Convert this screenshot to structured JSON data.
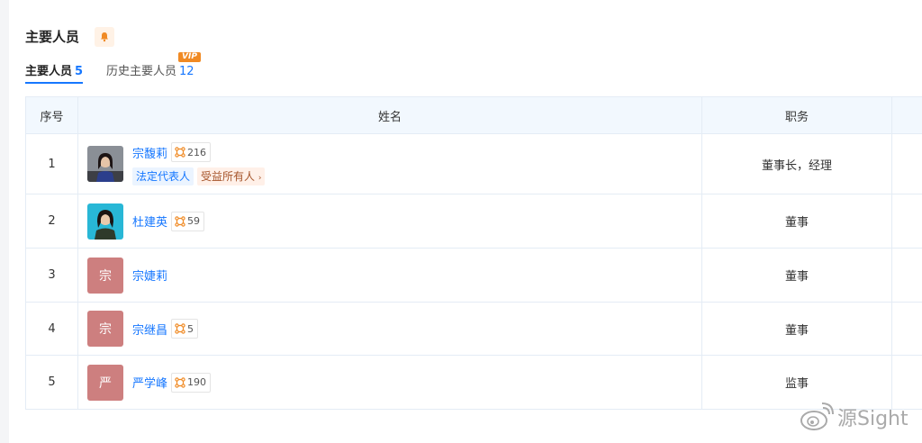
{
  "section": {
    "title": "主要人员"
  },
  "tabs": [
    {
      "label": "主要人员",
      "count": "5"
    },
    {
      "label": "历史主要人员",
      "count": "12",
      "badge": "VIP"
    }
  ],
  "table": {
    "headers": {
      "index": "序号",
      "name": "姓名",
      "role": "职务"
    },
    "rows": [
      {
        "index": "1",
        "name": "宗馥莉",
        "links": "216",
        "role": "董事长，经理",
        "avatar": "photo",
        "tags": [
          "法定代表人",
          "受益所有人"
        ]
      },
      {
        "index": "2",
        "name": "杜建英",
        "links": "59",
        "role": "董事",
        "avatar": "photo"
      },
      {
        "index": "3",
        "name": "宗婕莉",
        "role": "董事",
        "avatar_letter": "宗"
      },
      {
        "index": "4",
        "name": "宗继昌",
        "links": "5",
        "role": "董事",
        "avatar_letter": "宗"
      },
      {
        "index": "5",
        "name": "严学峰",
        "links": "190",
        "role": "监事",
        "avatar_letter": "严"
      }
    ]
  },
  "watermark": {
    "text": "源Sight"
  },
  "colors": {
    "accent": "#1677ff",
    "bell": "#f08a24",
    "avatar_letter_bg": "#cd7f7f"
  }
}
